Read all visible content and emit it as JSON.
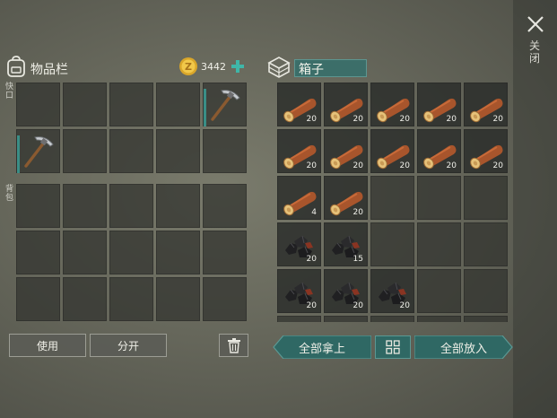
{
  "close": {
    "icon": "close-icon",
    "label": "关闭"
  },
  "inventory": {
    "title": "物品栏",
    "icon": "backpack-icon",
    "coins": "3442",
    "coin_icon": "coin-icon",
    "add_icon": "plus-icon",
    "hotbar_label": "快口",
    "backpack_label": "背包",
    "hotbar": [
      {
        "item": null
      },
      {
        "item": null
      },
      {
        "item": null
      },
      {
        "item": null
      },
      {
        "item": "pickaxe",
        "accent": true
      },
      {
        "item": "pickaxe",
        "accent": true
      },
      {
        "item": null
      },
      {
        "item": null
      },
      {
        "item": null
      },
      {
        "item": null
      }
    ],
    "backpack": [
      {
        "item": null
      },
      {
        "item": null
      },
      {
        "item": null
      },
      {
        "item": null
      },
      {
        "item": null
      },
      {
        "item": null
      },
      {
        "item": null
      },
      {
        "item": null
      },
      {
        "item": null
      },
      {
        "item": null
      },
      {
        "item": null
      },
      {
        "item": null
      },
      {
        "item": null
      },
      {
        "item": null
      },
      {
        "item": null
      }
    ]
  },
  "chest": {
    "title": "箱子",
    "icon": "chest-icon",
    "slots": [
      {
        "item": "log",
        "qty": "20"
      },
      {
        "item": "log",
        "qty": "20"
      },
      {
        "item": "log",
        "qty": "20"
      },
      {
        "item": "log",
        "qty": "20"
      },
      {
        "item": "log",
        "qty": "20"
      },
      {
        "item": "log",
        "qty": "20"
      },
      {
        "item": "log",
        "qty": "20"
      },
      {
        "item": "log",
        "qty": "20"
      },
      {
        "item": "log",
        "qty": "20"
      },
      {
        "item": "log",
        "qty": "20"
      },
      {
        "item": "log",
        "qty": "4"
      },
      {
        "item": "log",
        "qty": "20"
      },
      {
        "item": null
      },
      {
        "item": null
      },
      {
        "item": null
      },
      {
        "item": "coal",
        "qty": "20"
      },
      {
        "item": "coal",
        "qty": "15"
      },
      {
        "item": null
      },
      {
        "item": null
      },
      {
        "item": null
      },
      {
        "item": "coal",
        "qty": "20"
      },
      {
        "item": "coal",
        "qty": "20"
      },
      {
        "item": "coal",
        "qty": "20"
      },
      {
        "item": null
      },
      {
        "item": null
      },
      {
        "item": null
      },
      {
        "item": null
      },
      {
        "item": null
      },
      {
        "item": null
      },
      {
        "item": null
      }
    ]
  },
  "buttons": {
    "use": "使用",
    "split": "分开",
    "trash_icon": "trash-icon",
    "take_all": "全部拿上",
    "sort_icon": "grid-sort-icon",
    "put_all": "全部放入"
  },
  "colors": {
    "accent_teal": "#3a8e86",
    "button_teal": "#2f6864"
  }
}
